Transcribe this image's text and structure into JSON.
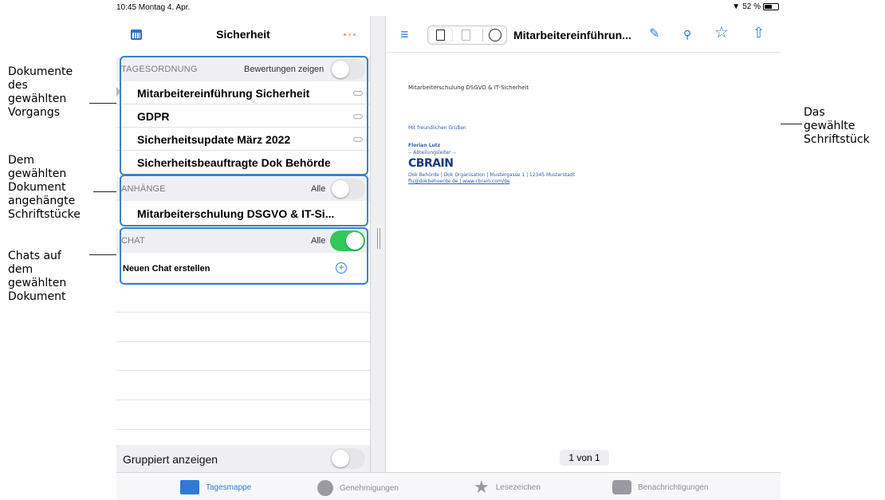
{
  "statusbar": {
    "time_date": "10:45  Montag 4. Apr.",
    "battery": "52 %"
  },
  "left": {
    "title": "Sicherheit",
    "agenda": {
      "label": "TAGESORDNUNG",
      "option": "Bewertungen zeigen",
      "toggle_on": false,
      "items": [
        {
          "label": "Mitarbeitereinführung Sicherheit",
          "attachment": true
        },
        {
          "label": "GDPR",
          "attachment": true
        },
        {
          "label": "Sicherheitsupdate März 2022",
          "attachment": true
        },
        {
          "label": "Sicherheitsbeauftragte Dok Behörde",
          "attachment": false
        }
      ]
    },
    "attachments": {
      "label": "ANHÄNGE",
      "option": "Alle",
      "toggle_on": false,
      "items": [
        {
          "label": "Mitarbeiterschulung DSGVO & IT-Si..."
        }
      ]
    },
    "chat": {
      "label": "CHAT",
      "option": "Alle",
      "toggle_on": true,
      "new_chat": "Neuen Chat erstellen"
    },
    "grouped_label": "Gruppiert anzeigen",
    "grouped_on": false
  },
  "right": {
    "doc_title": "Mitarbeitereinführun...",
    "document": {
      "subject": "Mitarbeiterschulung DSGVO & IT-Sicherheit",
      "greeting": "Mit freundlichen Grüßen",
      "name": "Florian Lutz",
      "role": "-- Abteilungsleiter --",
      "logo": "CBRAIN",
      "address": "Dok Behörde  |  Dok Organisation  |  Mustergasse 1  |  12345 Musterstadt",
      "links": "flu@dokbehoerde.de  |  www.cbrain.com/de"
    },
    "pager": "1 von 1"
  },
  "tabs": [
    {
      "label": "Tagesmappe",
      "icon": "calendar-icon",
      "active": true
    },
    {
      "label": "Genehmigungen",
      "icon": "approval-icon",
      "active": false
    },
    {
      "label": "Lesezeichen",
      "icon": "star-icon",
      "active": false
    },
    {
      "label": "Benachrichtigungen",
      "icon": "chat-bubble-icon",
      "active": false
    }
  ],
  "annotations": {
    "docs": [
      "Dokumente",
      "des",
      "gewählten",
      "Vorgangs"
    ],
    "attached": [
      "Dem",
      "gewählten",
      "Dokument",
      "angehängte",
      "Schriftstücke"
    ],
    "chats": [
      "Chats auf",
      "dem",
      "gewählten",
      "Dokument"
    ],
    "selected": [
      "Das",
      "gewählte",
      "Schriftstück"
    ]
  },
  "colors": {
    "accent": "#2f7ad6",
    "highlight_box": "#3b82c4",
    "toggle_on": "#34c759"
  }
}
